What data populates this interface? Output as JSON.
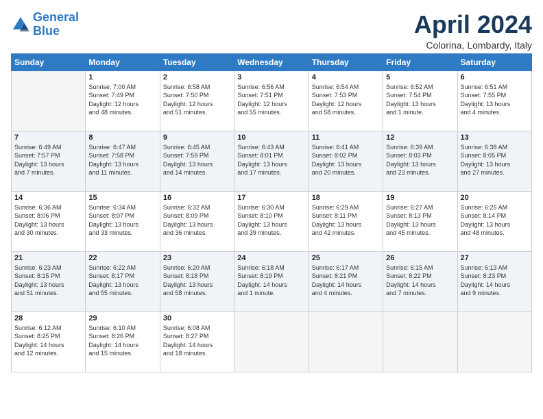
{
  "logo": {
    "line1": "General",
    "line2": "Blue"
  },
  "title": "April 2024",
  "location": "Colorina, Lombardy, Italy",
  "weekdays": [
    "Sunday",
    "Monday",
    "Tuesday",
    "Wednesday",
    "Thursday",
    "Friday",
    "Saturday"
  ],
  "weeks": [
    [
      {
        "day": "",
        "info": ""
      },
      {
        "day": "1",
        "info": "Sunrise: 7:00 AM\nSunset: 7:49 PM\nDaylight: 12 hours\nand 48 minutes."
      },
      {
        "day": "2",
        "info": "Sunrise: 6:58 AM\nSunset: 7:50 PM\nDaylight: 12 hours\nand 51 minutes."
      },
      {
        "day": "3",
        "info": "Sunrise: 6:56 AM\nSunset: 7:51 PM\nDaylight: 12 hours\nand 55 minutes."
      },
      {
        "day": "4",
        "info": "Sunrise: 6:54 AM\nSunset: 7:53 PM\nDaylight: 12 hours\nand 58 minutes."
      },
      {
        "day": "5",
        "info": "Sunrise: 6:52 AM\nSunset: 7:54 PM\nDaylight: 13 hours\nand 1 minute."
      },
      {
        "day": "6",
        "info": "Sunrise: 6:51 AM\nSunset: 7:55 PM\nDaylight: 13 hours\nand 4 minutes."
      }
    ],
    [
      {
        "day": "7",
        "info": "Sunrise: 6:49 AM\nSunset: 7:57 PM\nDaylight: 13 hours\nand 7 minutes."
      },
      {
        "day": "8",
        "info": "Sunrise: 6:47 AM\nSunset: 7:58 PM\nDaylight: 13 hours\nand 11 minutes."
      },
      {
        "day": "9",
        "info": "Sunrise: 6:45 AM\nSunset: 7:59 PM\nDaylight: 13 hours\nand 14 minutes."
      },
      {
        "day": "10",
        "info": "Sunrise: 6:43 AM\nSunset: 8:01 PM\nDaylight: 13 hours\nand 17 minutes."
      },
      {
        "day": "11",
        "info": "Sunrise: 6:41 AM\nSunset: 8:02 PM\nDaylight: 13 hours\nand 20 minutes."
      },
      {
        "day": "12",
        "info": "Sunrise: 6:39 AM\nSunset: 8:03 PM\nDaylight: 13 hours\nand 23 minutes."
      },
      {
        "day": "13",
        "info": "Sunrise: 6:38 AM\nSunset: 8:05 PM\nDaylight: 13 hours\nand 27 minutes."
      }
    ],
    [
      {
        "day": "14",
        "info": "Sunrise: 6:36 AM\nSunset: 8:06 PM\nDaylight: 13 hours\nand 30 minutes."
      },
      {
        "day": "15",
        "info": "Sunrise: 6:34 AM\nSunset: 8:07 PM\nDaylight: 13 hours\nand 33 minutes."
      },
      {
        "day": "16",
        "info": "Sunrise: 6:32 AM\nSunset: 8:09 PM\nDaylight: 13 hours\nand 36 minutes."
      },
      {
        "day": "17",
        "info": "Sunrise: 6:30 AM\nSunset: 8:10 PM\nDaylight: 13 hours\nand 39 minutes."
      },
      {
        "day": "18",
        "info": "Sunrise: 6:29 AM\nSunset: 8:11 PM\nDaylight: 13 hours\nand 42 minutes."
      },
      {
        "day": "19",
        "info": "Sunrise: 6:27 AM\nSunset: 8:13 PM\nDaylight: 13 hours\nand 45 minutes."
      },
      {
        "day": "20",
        "info": "Sunrise: 6:25 AM\nSunset: 8:14 PM\nDaylight: 13 hours\nand 48 minutes."
      }
    ],
    [
      {
        "day": "21",
        "info": "Sunrise: 6:23 AM\nSunset: 8:15 PM\nDaylight: 13 hours\nand 51 minutes."
      },
      {
        "day": "22",
        "info": "Sunrise: 6:22 AM\nSunset: 8:17 PM\nDaylight: 13 hours\nand 55 minutes."
      },
      {
        "day": "23",
        "info": "Sunrise: 6:20 AM\nSunset: 8:18 PM\nDaylight: 13 hours\nand 58 minutes."
      },
      {
        "day": "24",
        "info": "Sunrise: 6:18 AM\nSunset: 8:19 PM\nDaylight: 14 hours\nand 1 minute."
      },
      {
        "day": "25",
        "info": "Sunrise: 6:17 AM\nSunset: 8:21 PM\nDaylight: 14 hours\nand 4 minutes."
      },
      {
        "day": "26",
        "info": "Sunrise: 6:15 AM\nSunset: 8:22 PM\nDaylight: 14 hours\nand 7 minutes."
      },
      {
        "day": "27",
        "info": "Sunrise: 6:13 AM\nSunset: 8:23 PM\nDaylight: 14 hours\nand 9 minutes."
      }
    ],
    [
      {
        "day": "28",
        "info": "Sunrise: 6:12 AM\nSunset: 8:25 PM\nDaylight: 14 hours\nand 12 minutes."
      },
      {
        "day": "29",
        "info": "Sunrise: 6:10 AM\nSunset: 8:26 PM\nDaylight: 14 hours\nand 15 minutes."
      },
      {
        "day": "30",
        "info": "Sunrise: 6:08 AM\nSunset: 8:27 PM\nDaylight: 14 hours\nand 18 minutes."
      },
      {
        "day": "",
        "info": ""
      },
      {
        "day": "",
        "info": ""
      },
      {
        "day": "",
        "info": ""
      },
      {
        "day": "",
        "info": ""
      }
    ]
  ]
}
